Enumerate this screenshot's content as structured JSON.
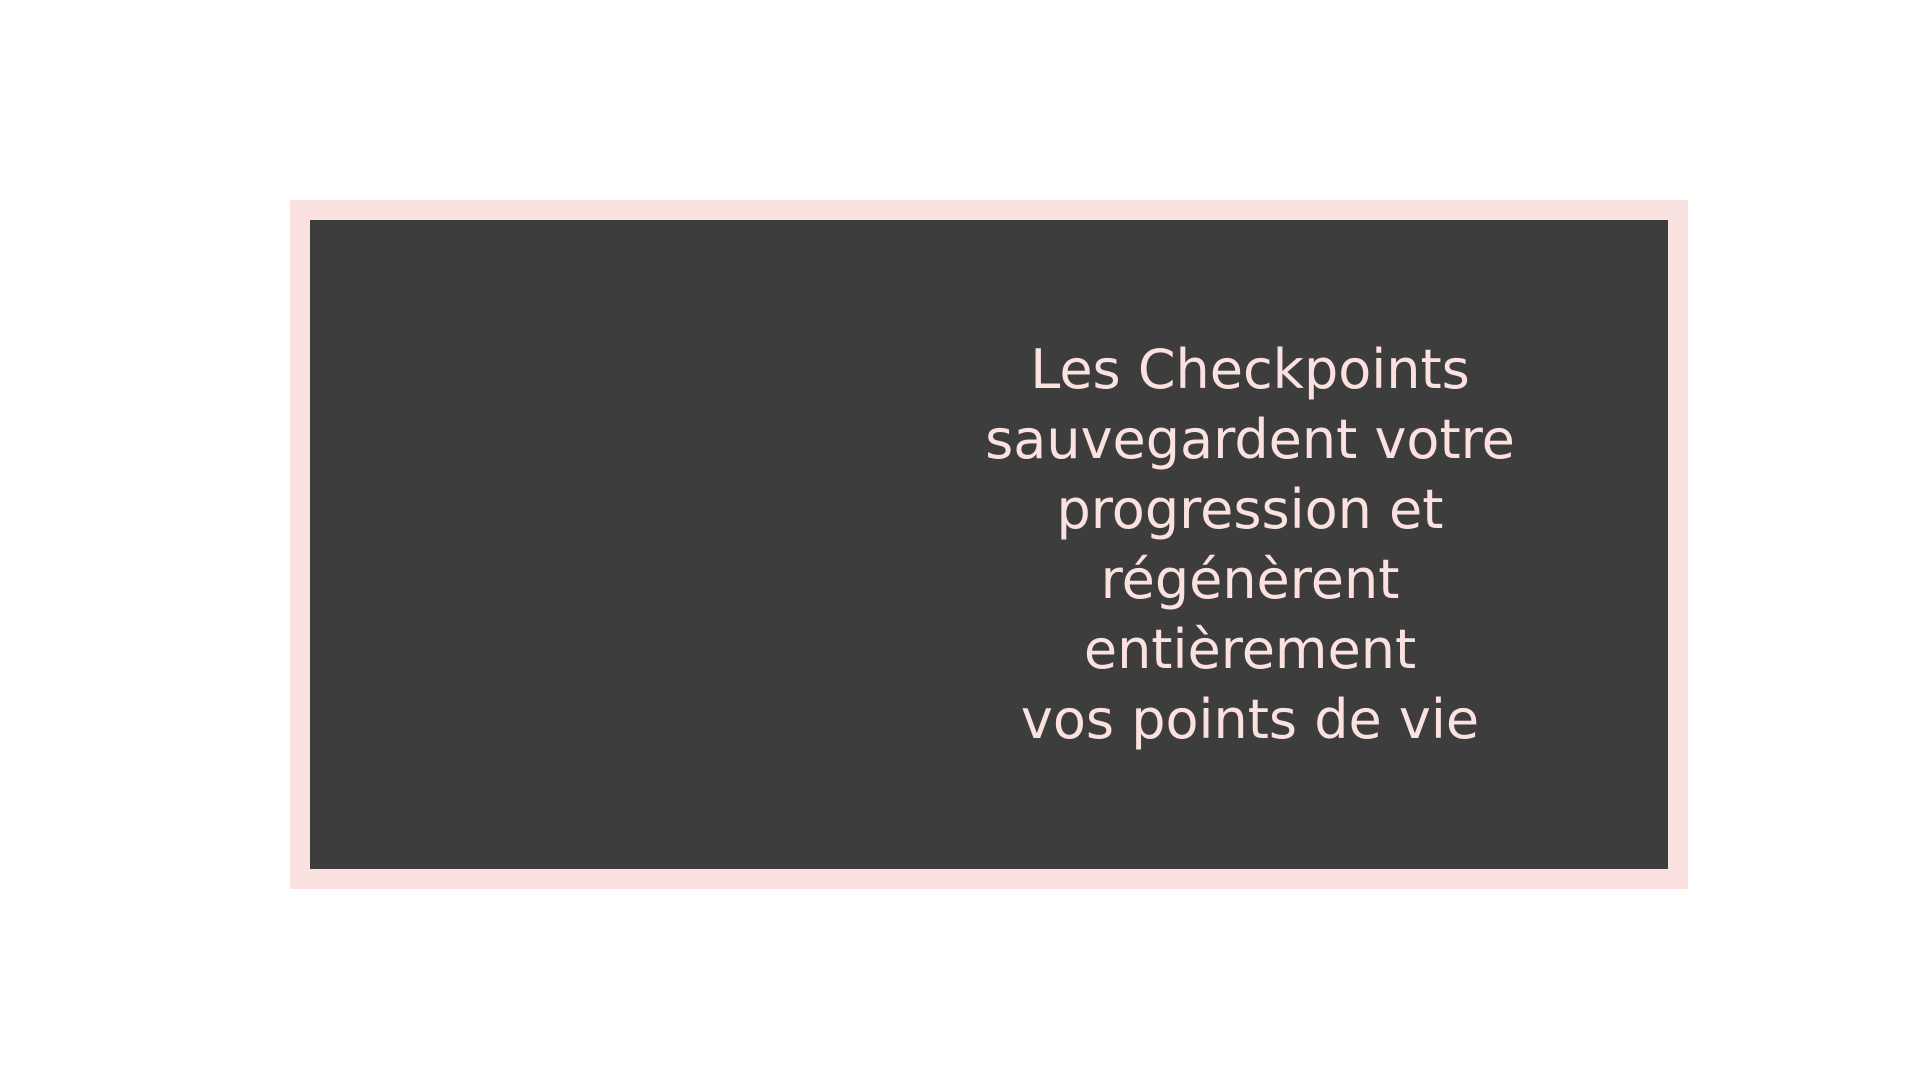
{
  "slide": {
    "message": "Les Checkpoints\nsauvegardent votre\nprogression et\nrégénèrent entièrement\nvos points de vie"
  },
  "colors": {
    "background": "#ffffff",
    "frame": "#fce1e1",
    "panel": "#3e3d3d",
    "text": "#fce1e1"
  }
}
